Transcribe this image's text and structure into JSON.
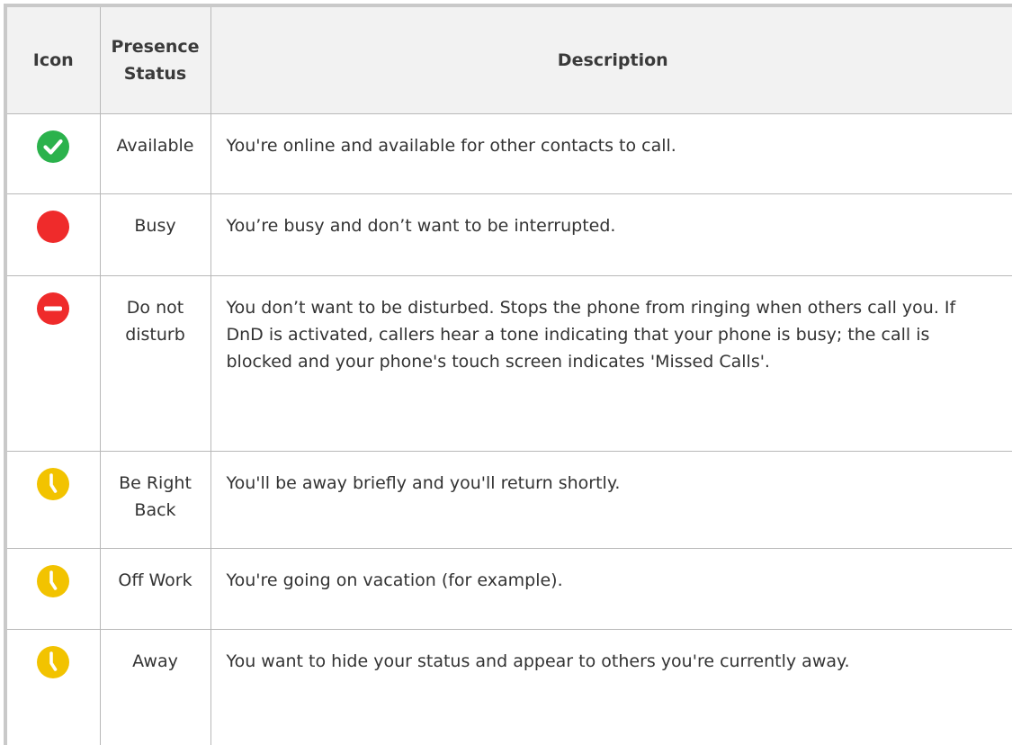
{
  "table": {
    "headers": {
      "icon": "Icon",
      "status_line1": "Presence",
      "status_line2": "Status",
      "description": "Description"
    },
    "rows": [
      {
        "icon": "available-check-icon",
        "icon_color": "#2bb24c",
        "status": "Available",
        "description": "You're online and available for other contacts to call."
      },
      {
        "icon": "busy-dot-icon",
        "icon_color": "#ef2b2b",
        "status": "Busy",
        "description": "You’re busy and don’t want to be interrupted."
      },
      {
        "icon": "do-not-disturb-icon",
        "icon_color": "#ef2b2b",
        "status": "Do not disturb",
        "description": "You don’t want to be disturbed. Stops the phone from ringing when others call you. If DnD is activated, callers hear a tone indicating that your phone is busy; the call is blocked and your phone's touch screen indicates 'Missed Calls'."
      },
      {
        "icon": "clock-icon",
        "icon_color": "#f2c300",
        "status": "Be Right Back",
        "description": "You'll be away briefly and you'll return shortly."
      },
      {
        "icon": "clock-icon",
        "icon_color": "#f2c300",
        "status": "Off Work",
        "description": "You're going on vacation (for example)."
      },
      {
        "icon": "clock-icon",
        "icon_color": "#f2c300",
        "status": "Away",
        "description": "You want to hide your status and appear to others you're currently away."
      }
    ]
  }
}
